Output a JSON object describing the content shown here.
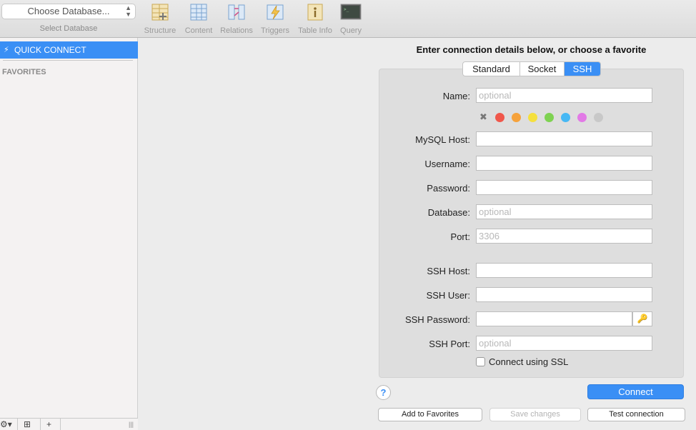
{
  "toolbar": {
    "db_select": "Choose Database...",
    "db_caption": "Select Database",
    "tools": [
      {
        "label": "Structure",
        "icon": "structure-icon"
      },
      {
        "label": "Content",
        "icon": "content-icon"
      },
      {
        "label": "Relations",
        "icon": "relations-icon"
      },
      {
        "label": "Triggers",
        "icon": "triggers-icon"
      },
      {
        "label": "Table Info",
        "icon": "table-info-icon"
      },
      {
        "label": "Query",
        "icon": "query-icon"
      }
    ]
  },
  "sidebar": {
    "quick_connect": "QUICK CONNECT",
    "favorites": "FAVORITES",
    "bottom": {
      "gear": "⚙▾",
      "add_folder": "⊞",
      "add": "+",
      "resize": "|||"
    }
  },
  "main": {
    "heading": "Enter connection details below, or choose a favorite",
    "tabs": [
      "Standard",
      "Socket",
      "SSH"
    ],
    "active_tab": "SSH",
    "form": {
      "name_label": "Name:",
      "name_placeholder": "optional",
      "mysql_host_label": "MySQL Host:",
      "username_label": "Username:",
      "password_label": "Password:",
      "database_label": "Database:",
      "database_placeholder": "optional",
      "port_label": "Port:",
      "port_placeholder": "3306",
      "ssh_host_label": "SSH Host:",
      "ssh_user_label": "SSH User:",
      "ssh_password_label": "SSH Password:",
      "ssh_port_label": "SSH Port:",
      "ssh_port_placeholder": "optional",
      "ssl_label": "Connect using SSL",
      "key_icon": "🔑"
    },
    "colors": {
      "clear": "✖",
      "swatches": [
        "#f0574b",
        "#f6a23b",
        "#f5e03d",
        "#7ed251",
        "#47b8f4",
        "#e27ae6",
        "#c8c8c8"
      ]
    },
    "buttons": {
      "help": "?",
      "connect": "Connect",
      "add_favorites": "Add to Favorites",
      "save_changes": "Save changes",
      "test_connection": "Test connection"
    },
    "accent": "#3a8ff5"
  }
}
